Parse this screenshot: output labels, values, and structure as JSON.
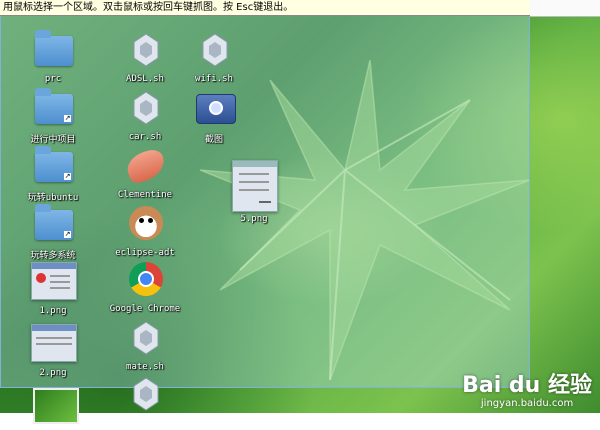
{
  "hint_bar": {
    "text": "用鼠标选择一个区域。双击鼠标或按回车键抓图。按 Esc键退出。"
  },
  "desktop_icons": [
    {
      "label": "prc",
      "kind": "folder"
    },
    {
      "label": "进行中项目",
      "kind": "folder"
    },
    {
      "label": "玩转ubuntu",
      "kind": "folder"
    },
    {
      "label": "玩转多系统",
      "kind": "folder"
    },
    {
      "label": "1.png",
      "kind": "image"
    },
    {
      "label": "2.png",
      "kind": "image"
    },
    {
      "label": "",
      "kind": "image"
    },
    {
      "label": "ADSL.sh",
      "kind": "script"
    },
    {
      "label": "car.sh",
      "kind": "script"
    },
    {
      "label": "Clementine",
      "kind": "app"
    },
    {
      "label": "eclipse-adt",
      "kind": "app"
    },
    {
      "label": "Google Chrome",
      "kind": "app"
    },
    {
      "label": "mate.sh",
      "kind": "script"
    },
    {
      "label": "",
      "kind": "script"
    },
    {
      "label": "wifi.sh",
      "kind": "script"
    },
    {
      "label": "截图",
      "kind": "app"
    },
    {
      "label": "5.png",
      "kind": "image"
    }
  ],
  "watermark": {
    "brand": "Bai du 经验",
    "url": "jingyan.baidu.com"
  },
  "colors": {
    "selection": "#aad7eb",
    "hint_bg": "#ffffe1",
    "folder": "#4d8fcf"
  }
}
